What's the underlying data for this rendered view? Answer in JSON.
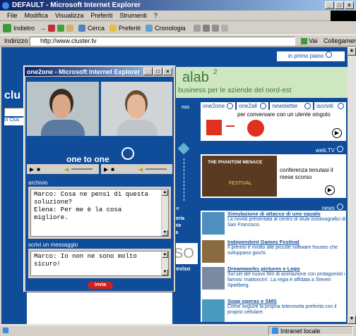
{
  "browser": {
    "title": "DEFAULT - Microsoft Internet Explorer",
    "menu": [
      "File",
      "Modifica",
      "Visualizza",
      "Preferiti",
      "Strumenti",
      "?"
    ],
    "toolbar": {
      "back": "Indietro",
      "search": "Cerca",
      "favorites": "Preferiti",
      "history": "Cronologia"
    },
    "address_label": "Indirizzo",
    "address_value": "http://www.cluster.tv",
    "go": "Vai",
    "links": "Collegamenti",
    "status_zone": "Intranet locale"
  },
  "site": {
    "in_primo_piano": "in primo piano",
    "banner_title": "alab",
    "banner_sup": "2",
    "banner_sub": "business per le aziende del nord-est",
    "tabs": [
      "one2one",
      "one2all",
      "newsletter",
      "iscriviti"
    ],
    "one2one_caption": "per conversare con un utente singolo",
    "webtv_label": "web.TV",
    "webtv_film": "THE PHANTOM MENACE",
    "webtv_festival": "FESTIVAL",
    "webtv_caption": "conferenza tenutasi il mese scorso",
    "news_label": "news",
    "news": [
      {
        "title": "Simulazione di attacco di uno squalo",
        "desc": "La novità presentata al centro di studi oceanografici di San Francisco."
      },
      {
        "title": "Independent Games Festival",
        "desc": "Il premio è rivolto alle piccole software houses che sviluppano giochi."
      },
      {
        "title": "Dreamworks pictures e Lego",
        "desc": "Sul set del nuovo film di animazione con protagonisti i famosi 'mattoncini'. La regia è affidata a Steven Spielberg."
      },
      {
        "title": "Soap operas e SMS",
        "desc": "Come seguire la propria telenovela preferita con il proprio cellulare."
      }
    ],
    "left_logo": "clu",
    "left_field": "in Clus",
    "left_text1": "ee",
    "left_text2": "toria",
    "left_text3": "nte",
    "left_text4": "ta",
    "left_text5": "SO",
    "left_text6": "reviso"
  },
  "popup": {
    "title": "one2one - Microsoft Internet Explorer",
    "one_to_one": "one to one",
    "archivio_label": "archivio",
    "archivio_text": "Marco: Cosa ne pensi di questa\nsoluzione?\nElena: Per me è la cosa migliore.",
    "scrivi_label": "scrivi un messaggio",
    "scrivi_text": "Marco: Io non ne sono molto sicuro!",
    "send": "invia"
  }
}
